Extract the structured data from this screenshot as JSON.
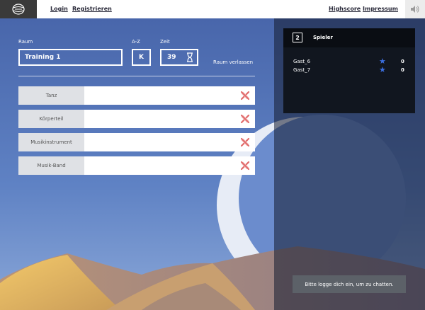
{
  "nav": {
    "login": "Login",
    "register": "Registrieren",
    "highscore": "Highscore",
    "impressum": "Impressum"
  },
  "room": {
    "room_label": "Raum",
    "room_value": "Training 1",
    "letter_label": "A-Z",
    "letter_value": "K",
    "time_label": "Zeit",
    "time_value": "39",
    "leave_label": "Raum verlassen"
  },
  "categories": [
    {
      "label": "Tanz",
      "answer": ""
    },
    {
      "label": "Körperteil",
      "answer": ""
    },
    {
      "label": "Musikinstrument",
      "answer": ""
    },
    {
      "label": "Musik-Band",
      "answer": ""
    }
  ],
  "players": {
    "count": "2",
    "title": "Spieler",
    "list": [
      {
        "name": "Gast_6",
        "score": "0"
      },
      {
        "name": "Gast_7",
        "score": "0"
      }
    ]
  },
  "chat": {
    "login_prompt": "Bitte logge dich ein, um zu chatten."
  },
  "icons": {
    "logo": "globe-logo-icon",
    "speaker": "speaker-icon",
    "hourglass": "hourglass-icon",
    "remove": "close-x-icon",
    "star": "star-icon"
  },
  "colors": {
    "remove_x": "#e06a6a",
    "star": "#3b6fe0",
    "accent_sand": "#f0c56a"
  }
}
